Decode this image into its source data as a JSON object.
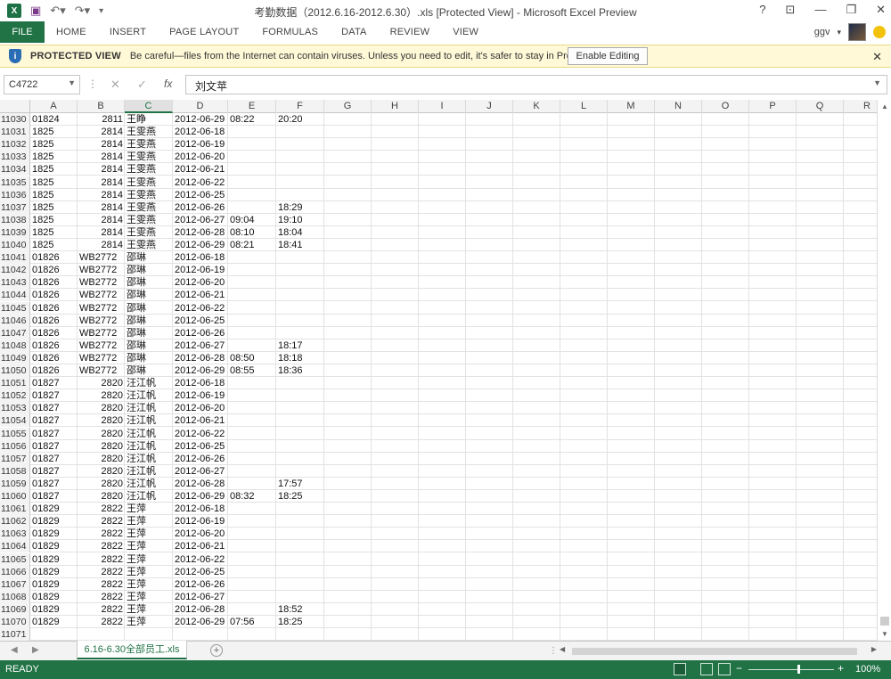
{
  "window": {
    "title": "考勤数据（2012.6.16-2012.6.30）.xls  [Protected View] - Microsoft Excel Preview",
    "app_icon": "excel-logo-icon",
    "controls": [
      "?",
      "⊡",
      "—",
      "❐",
      "✕"
    ]
  },
  "ribbon": {
    "file": "FILE",
    "tabs": [
      "HOME",
      "INSERT",
      "PAGE LAYOUT",
      "FORMULAS",
      "DATA",
      "REVIEW",
      "VIEW"
    ],
    "user": "ggv"
  },
  "protected_view": {
    "title": "PROTECTED VIEW",
    "message": "Be careful—files from the Internet can contain viruses. Unless you need to edit, it's safer to stay in Protected View.",
    "button": "Enable Editing",
    "close": "✕"
  },
  "formula_bar": {
    "name_box": "C4722",
    "fx": "fx",
    "content": "刘文苹"
  },
  "columns": [
    "A",
    "B",
    "C",
    "D",
    "E",
    "F",
    "G",
    "H",
    "I",
    "J",
    "K",
    "L",
    "M",
    "N",
    "O",
    "P",
    "Q",
    "R"
  ],
  "selected_column": "C",
  "rows": [
    {
      "n": "11030",
      "a": "01824",
      "b": "2811",
      "c": "王睁",
      "d": "2012-06-29",
      "e": "08:22",
      "f": "20:20"
    },
    {
      "n": "11031",
      "a": "1825",
      "b": "2814",
      "c": "王雯燕",
      "d": "2012-06-18",
      "e": "",
      "f": ""
    },
    {
      "n": "11032",
      "a": "1825",
      "b": "2814",
      "c": "王雯燕",
      "d": "2012-06-19",
      "e": "",
      "f": ""
    },
    {
      "n": "11033",
      "a": "1825",
      "b": "2814",
      "c": "王雯燕",
      "d": "2012-06-20",
      "e": "",
      "f": ""
    },
    {
      "n": "11034",
      "a": "1825",
      "b": "2814",
      "c": "王雯燕",
      "d": "2012-06-21",
      "e": "",
      "f": ""
    },
    {
      "n": "11035",
      "a": "1825",
      "b": "2814",
      "c": "王雯燕",
      "d": "2012-06-22",
      "e": "",
      "f": ""
    },
    {
      "n": "11036",
      "a": "1825",
      "b": "2814",
      "c": "王雯燕",
      "d": "2012-06-25",
      "e": "",
      "f": ""
    },
    {
      "n": "11037",
      "a": "1825",
      "b": "2814",
      "c": "王雯燕",
      "d": "2012-06-26",
      "e": "",
      "f": "18:29"
    },
    {
      "n": "11038",
      "a": "1825",
      "b": "2814",
      "c": "王雯燕",
      "d": "2012-06-27",
      "e": "09:04",
      "f": "19:10"
    },
    {
      "n": "11039",
      "a": "1825",
      "b": "2814",
      "c": "王雯燕",
      "d": "2012-06-28",
      "e": "08:10",
      "f": "18:04"
    },
    {
      "n": "11040",
      "a": "1825",
      "b": "2814",
      "c": "王雯燕",
      "d": "2012-06-29",
      "e": "08:21",
      "f": "18:41"
    },
    {
      "n": "11041",
      "a": "01826",
      "b": "WB2772",
      "c": "邵琳",
      "d": "2012-06-18",
      "e": "",
      "f": ""
    },
    {
      "n": "11042",
      "a": "01826",
      "b": "WB2772",
      "c": "邵琳",
      "d": "2012-06-19",
      "e": "",
      "f": ""
    },
    {
      "n": "11043",
      "a": "01826",
      "b": "WB2772",
      "c": "邵琳",
      "d": "2012-06-20",
      "e": "",
      "f": ""
    },
    {
      "n": "11044",
      "a": "01826",
      "b": "WB2772",
      "c": "邵琳",
      "d": "2012-06-21",
      "e": "",
      "f": ""
    },
    {
      "n": "11045",
      "a": "01826",
      "b": "WB2772",
      "c": "邵琳",
      "d": "2012-06-22",
      "e": "",
      "f": ""
    },
    {
      "n": "11046",
      "a": "01826",
      "b": "WB2772",
      "c": "邵琳",
      "d": "2012-06-25",
      "e": "",
      "f": ""
    },
    {
      "n": "11047",
      "a": "01826",
      "b": "WB2772",
      "c": "邵琳",
      "d": "2012-06-26",
      "e": "",
      "f": ""
    },
    {
      "n": "11048",
      "a": "01826",
      "b": "WB2772",
      "c": "邵琳",
      "d": "2012-06-27",
      "e": "",
      "f": "18:17"
    },
    {
      "n": "11049",
      "a": "01826",
      "b": "WB2772",
      "c": "邵琳",
      "d": "2012-06-28",
      "e": "08:50",
      "f": "18:18"
    },
    {
      "n": "11050",
      "a": "01826",
      "b": "WB2772",
      "c": "邵琳",
      "d": "2012-06-29",
      "e": "08:55",
      "f": "18:36"
    },
    {
      "n": "11051",
      "a": "01827",
      "b": "2820",
      "c": "汪江帆",
      "d": "2012-06-18",
      "e": "",
      "f": ""
    },
    {
      "n": "11052",
      "a": "01827",
      "b": "2820",
      "c": "汪江帆",
      "d": "2012-06-19",
      "e": "",
      "f": ""
    },
    {
      "n": "11053",
      "a": "01827",
      "b": "2820",
      "c": "汪江帆",
      "d": "2012-06-20",
      "e": "",
      "f": ""
    },
    {
      "n": "11054",
      "a": "01827",
      "b": "2820",
      "c": "汪江帆",
      "d": "2012-06-21",
      "e": "",
      "f": ""
    },
    {
      "n": "11055",
      "a": "01827",
      "b": "2820",
      "c": "汪江帆",
      "d": "2012-06-22",
      "e": "",
      "f": ""
    },
    {
      "n": "11056",
      "a": "01827",
      "b": "2820",
      "c": "汪江帆",
      "d": "2012-06-25",
      "e": "",
      "f": ""
    },
    {
      "n": "11057",
      "a": "01827",
      "b": "2820",
      "c": "汪江帆",
      "d": "2012-06-26",
      "e": "",
      "f": ""
    },
    {
      "n": "11058",
      "a": "01827",
      "b": "2820",
      "c": "汪江帆",
      "d": "2012-06-27",
      "e": "",
      "f": ""
    },
    {
      "n": "11059",
      "a": "01827",
      "b": "2820",
      "c": "汪江帆",
      "d": "2012-06-28",
      "e": "",
      "f": "17:57"
    },
    {
      "n": "11060",
      "a": "01827",
      "b": "2820",
      "c": "汪江帆",
      "d": "2012-06-29",
      "e": "08:32",
      "f": "18:25"
    },
    {
      "n": "11061",
      "a": "01829",
      "b": "2822",
      "c": "王萍",
      "d": "2012-06-18",
      "e": "",
      "f": ""
    },
    {
      "n": "11062",
      "a": "01829",
      "b": "2822",
      "c": "王萍",
      "d": "2012-06-19",
      "e": "",
      "f": ""
    },
    {
      "n": "11063",
      "a": "01829",
      "b": "2822",
      "c": "王萍",
      "d": "2012-06-20",
      "e": "",
      "f": ""
    },
    {
      "n": "11064",
      "a": "01829",
      "b": "2822",
      "c": "王萍",
      "d": "2012-06-21",
      "e": "",
      "f": ""
    },
    {
      "n": "11065",
      "a": "01829",
      "b": "2822",
      "c": "王萍",
      "d": "2012-06-22",
      "e": "",
      "f": ""
    },
    {
      "n": "11066",
      "a": "01829",
      "b": "2822",
      "c": "王萍",
      "d": "2012-06-25",
      "e": "",
      "f": ""
    },
    {
      "n": "11067",
      "a": "01829",
      "b": "2822",
      "c": "王萍",
      "d": "2012-06-26",
      "e": "",
      "f": ""
    },
    {
      "n": "11068",
      "a": "01829",
      "b": "2822",
      "c": "王萍",
      "d": "2012-06-27",
      "e": "",
      "f": ""
    },
    {
      "n": "11069",
      "a": "01829",
      "b": "2822",
      "c": "王萍",
      "d": "2012-06-28",
      "e": "",
      "f": "18:52"
    },
    {
      "n": "11070",
      "a": "01829",
      "b": "2822",
      "c": "王萍",
      "d": "2012-06-29",
      "e": "07:56",
      "f": "18:25"
    },
    {
      "n": "11071",
      "a": "",
      "b": "",
      "c": "",
      "d": "",
      "e": "",
      "f": ""
    }
  ],
  "sheet_tab": "6.16-6.30全部员工.xls",
  "status": {
    "ready": "READY",
    "zoom": "100%"
  }
}
